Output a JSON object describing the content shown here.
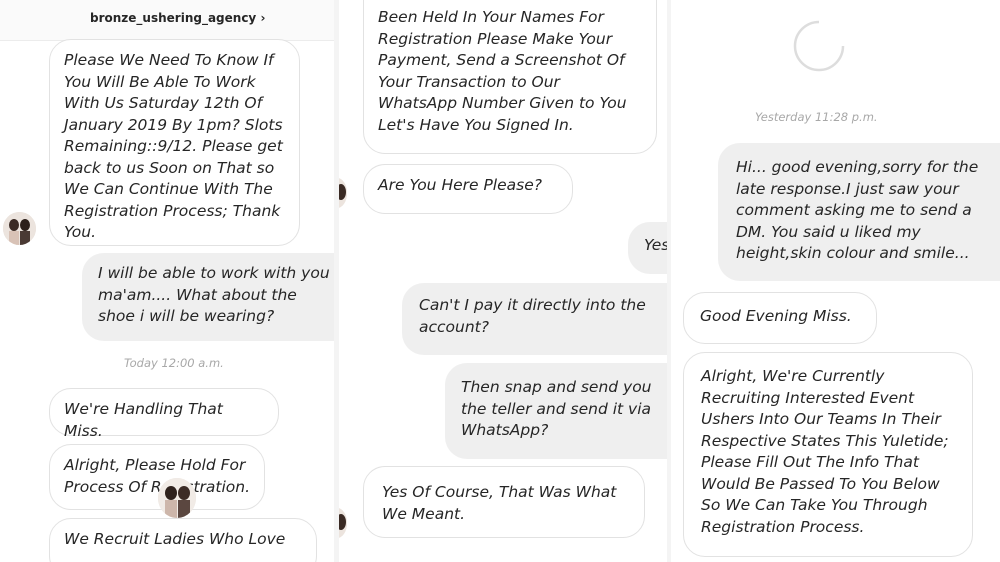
{
  "panel1": {
    "header": {
      "username": "bronze_ushering_agency",
      "chevron": "›"
    },
    "messages": [
      {
        "text": "Please We Need To Know If You Will Be Able To Work With Us Saturday 12th Of January 2019 By 1pm? Slots Remaining::9/12. Please get back to us Soon on That so We Can Continue With The Registration Process; Thank You."
      },
      {
        "text": "I will be able to work with you ma'am.... What about the shoe i will be wearing?"
      },
      {
        "text": "We're Handling That Miss."
      },
      {
        "text": "Alright, Please Hold For Process Of Registration."
      },
      {
        "text": "We Recruit Ladies Who Love"
      }
    ],
    "timestamp": "Today 12:00 a.m."
  },
  "panel2": {
    "messages": [
      {
        "text": "Been Held In Your Names For Registration Please Make Your Payment, Send a Screenshot Of Your Transaction to Our WhatsApp Number Given to You Let's Have You Signed In."
      },
      {
        "text": "Are You Here Please?"
      },
      {
        "text": "Yes"
      },
      {
        "text": "Can't I pay it directly into the account?"
      },
      {
        "text": "Then snap and send you the teller and send it via WhatsApp?"
      },
      {
        "text": "Yes Of Course, That Was What We Meant."
      }
    ]
  },
  "panel3": {
    "timestamp": "Yesterday 11:28 p.m.",
    "messages": [
      {
        "text": "Hi... good evening,sorry for the late response.I just saw your comment asking me to send a DM. You said u liked my height,skin colour and smile..."
      },
      {
        "text": "Good Evening Miss."
      },
      {
        "text": "Alright, We're Currently Recruiting Interested Event Ushers Into Our Teams In Their Respective States This Yuletide; Please Fill Out The Info That Would Be Passed To You Below So We Can Take You Through Registration Process."
      }
    ]
  }
}
